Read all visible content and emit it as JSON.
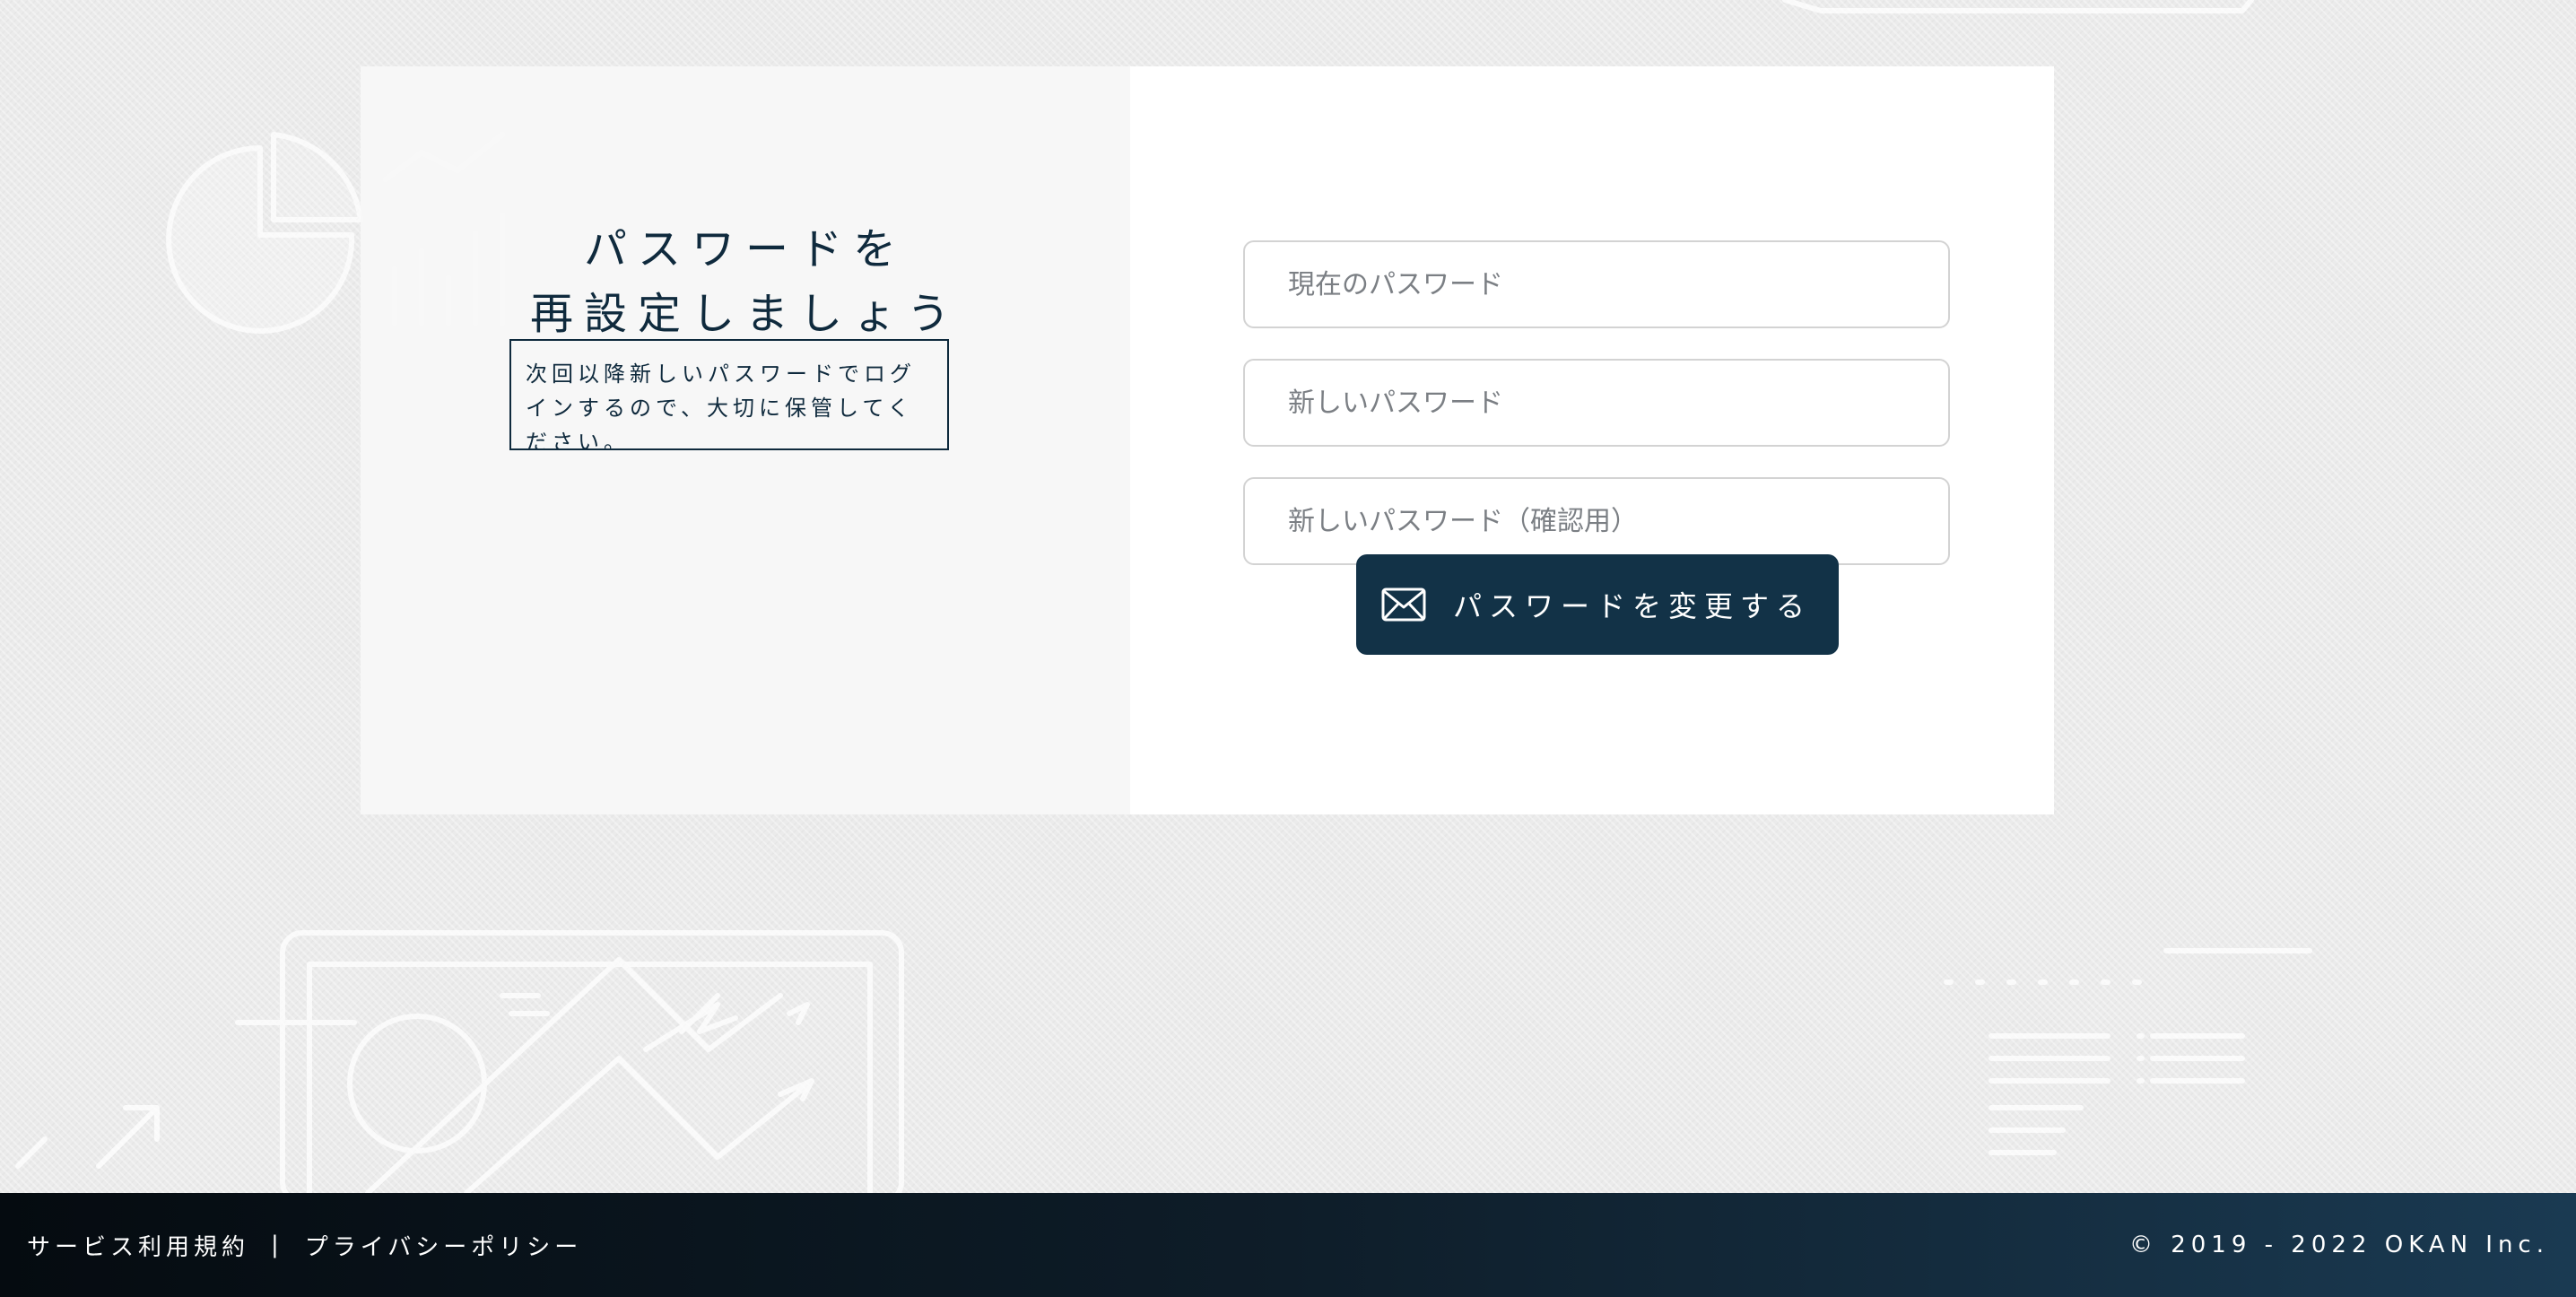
{
  "colors": {
    "navy": "#123247",
    "text": "#0f2a3d",
    "border": "#d3d3d3",
    "background": "#ebebeb"
  },
  "left_panel": {
    "heading_line1": "パスワードを",
    "heading_line2": "再設定しましょう",
    "note": "次回以降新しいパスワードでログインするので、大切に保管してください。"
  },
  "form": {
    "current_password_placeholder": "現在のパスワード",
    "new_password_placeholder": "新しいパスワード",
    "confirm_password_placeholder": "新しいパスワード（確認用）",
    "submit_label": "パスワードを変更する",
    "submit_icon": "envelope-icon"
  },
  "footer": {
    "terms_label": "サービス利用規約",
    "separator": "|",
    "privacy_label": "プライバシーポリシー",
    "copyright": "© 2019 - 2022 OKAN Inc."
  }
}
